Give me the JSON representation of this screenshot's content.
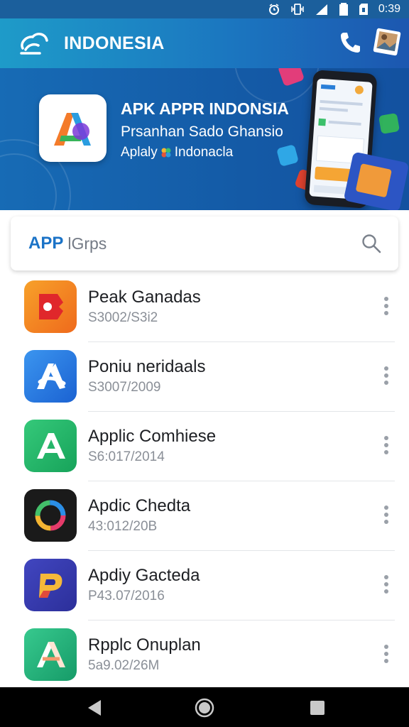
{
  "status_bar": {
    "time": "0:39",
    "icons": [
      "alarm-icon",
      "vibrate-icon",
      "signal-icon",
      "battery-icon",
      "sd-card-icon"
    ]
  },
  "app_bar": {
    "title": "INDONESIA",
    "logo_icon": "cloud-logo-icon",
    "action_icon": "phone-icon",
    "thumbnail_icon": "image-thumbnail-icon"
  },
  "banner": {
    "title": "APK APPR INDONSIA",
    "subtitle": "Prsanhan Sado Ghansio",
    "line": "Aplaly",
    "line_suffix": "Indonacla",
    "icon": "apk-logo-icon"
  },
  "search": {
    "brand": "APP",
    "placeholder": "lGrps",
    "icon": "search-icon"
  },
  "apps": [
    {
      "name": "Peak Ganadas",
      "date": "S3002/S3i2",
      "icon": "red-pin-icon",
      "colors": [
        "#f5931e",
        "#f16a1f"
      ]
    },
    {
      "name": "Poniu neridaals",
      "date": "S3007/2009",
      "icon": "blue-a-icon",
      "colors": [
        "#2e86e8",
        "#1a62d0"
      ]
    },
    {
      "name": "Applic Comhiese",
      "date": "S6:017/2014",
      "icon": "green-a-icon",
      "colors": [
        "#2dbf70",
        "#17a35a"
      ]
    },
    {
      "name": "Apdic Chedta",
      "date": "43:012/20B",
      "icon": "color-ring-icon",
      "colors": [
        "#1c1c1c",
        "#111111"
      ]
    },
    {
      "name": "Apdiy Gacteda",
      "date": "P43.07/2016",
      "icon": "purple-p-icon",
      "colors": [
        "#3a3fb4",
        "#2c2f9a"
      ]
    },
    {
      "name": "Rpplc Onuplan",
      "date": "5a9.02/26M",
      "icon": "teal-a-icon",
      "colors": [
        "#2fbf86",
        "#169b68"
      ]
    }
  ],
  "nav_bar": {
    "back_icon": "back-icon",
    "home_icon": "home-icon",
    "recents_icon": "recents-icon"
  }
}
